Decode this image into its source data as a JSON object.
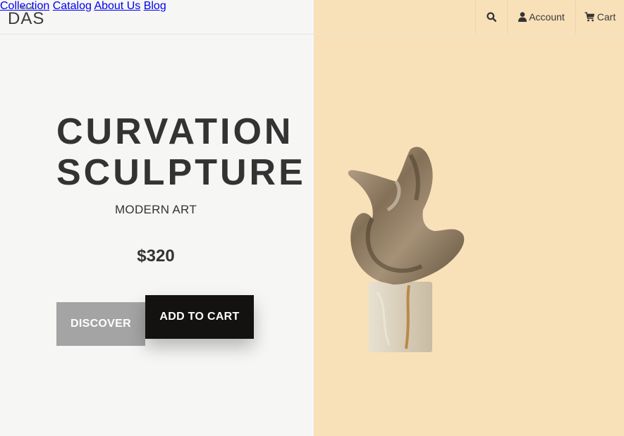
{
  "brand": {
    "logo_text": "DAS"
  },
  "nav": {
    "items": [
      {
        "label": "Collection"
      },
      {
        "label": "Catalog"
      },
      {
        "label": "About Us"
      },
      {
        "label": "Blog"
      }
    ]
  },
  "utilities": {
    "search_icon": "search-icon",
    "account_label": "Account",
    "cart_label": "Cart"
  },
  "hero": {
    "title_line1": "CURVATION",
    "title_line2": "SCULPTURE",
    "subtitle": "MODERN ART",
    "price": "$320",
    "discover_label": "DISCOVER",
    "add_to_cart_label": "ADD TO CART",
    "image": "sculpture-image"
  },
  "colors": {
    "left_bg": "#f6f6f5",
    "right_bg": "#f8e0b9",
    "discover_bg": "#a4a4a4",
    "cart_button_bg": "#141111"
  }
}
